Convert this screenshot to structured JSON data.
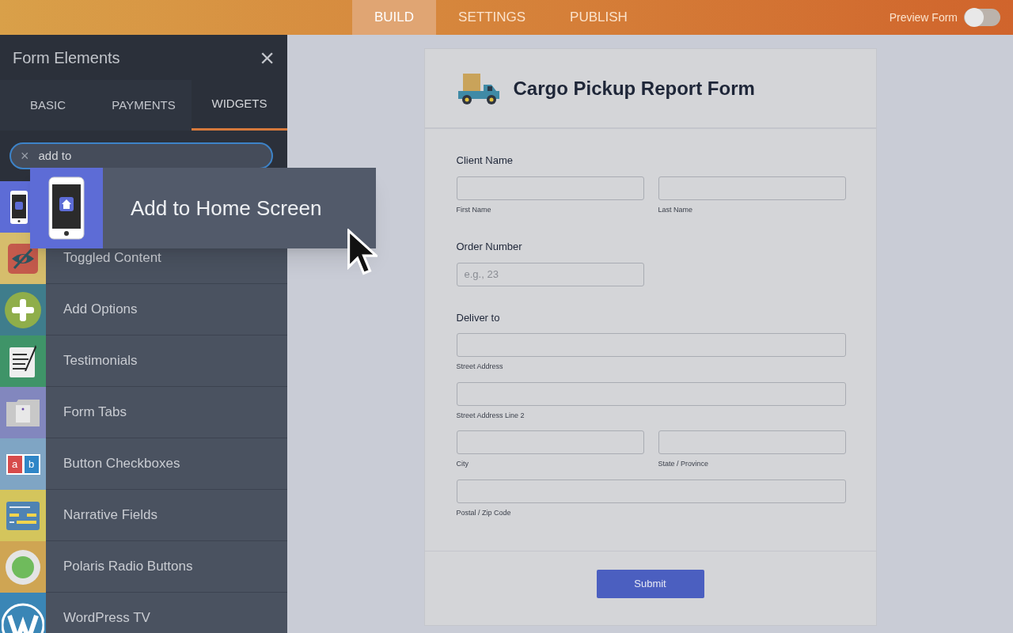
{
  "top_bar": {
    "tabs": [
      {
        "label": "BUILD",
        "selected": true
      },
      {
        "label": "SETTINGS",
        "selected": false
      },
      {
        "label": "PUBLISH",
        "selected": false
      }
    ],
    "preview_form": {
      "label": "Preview Form",
      "on": false
    }
  },
  "sidebar": {
    "title": "Form Elements",
    "close": "×",
    "tabs": [
      {
        "label": "BASIC",
        "selected": false
      },
      {
        "label": "PAYMENTS",
        "selected": false
      },
      {
        "label": "WIDGETS",
        "selected": true
      }
    ],
    "search": {
      "clear": "×",
      "value": "add to"
    },
    "items": [
      {
        "kind": "home"
      },
      {
        "kind": "toggle",
        "label": "Toggled Content"
      },
      {
        "kind": "plus",
        "label": "Add Options"
      },
      {
        "kind": "testimonial",
        "label": "Testimonials"
      },
      {
        "kind": "tabs",
        "label": "Form Tabs"
      },
      {
        "kind": "checkboxes",
        "label": "Button Checkboxes",
        "icon_text": [
          "a",
          "b"
        ]
      },
      {
        "kind": "narrative",
        "label": "Narrative Fields"
      },
      {
        "kind": "radio",
        "label": "Polaris Radio Buttons"
      },
      {
        "kind": "wordpress",
        "label": "WordPress TV"
      }
    ],
    "drag_card": {
      "kind": "home",
      "label": "Add to Home Screen"
    }
  },
  "form": {
    "title": "Cargo Pickup Report Form",
    "sections": [
      {
        "label": "Client Name",
        "rows": [
          [
            {
              "kind": "half",
              "sublabel": "First Name"
            },
            {
              "kind": "half",
              "sublabel": "Last Name"
            }
          ]
        ]
      },
      {
        "label": "Order Number",
        "rows": [
          [
            {
              "kind": "half",
              "placeholder": "e.g., 23"
            }
          ]
        ]
      },
      {
        "label": "Deliver to",
        "rows": [
          [
            {
              "kind": "full",
              "sublabel": "Street Address"
            }
          ],
          [
            {
              "kind": "full",
              "sublabel": "Street Address Line 2"
            }
          ],
          [
            {
              "kind": "half",
              "sublabel": "City"
            },
            {
              "kind": "half",
              "sublabel": "State / Province"
            }
          ],
          [
            {
              "kind": "full",
              "sublabel": "Postal / Zip Code"
            }
          ]
        ]
      }
    ],
    "submit": "Submit"
  }
}
